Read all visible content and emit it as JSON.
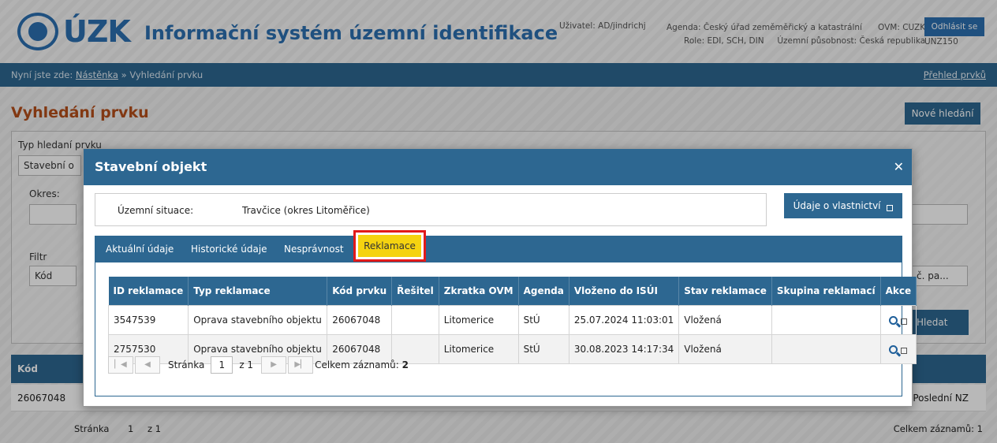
{
  "header": {
    "logo_text": "ÚZK",
    "app_title": "Informační systém územní identifikace",
    "user": "Uživatel: AD/jindrichj",
    "agenda": "Agenda: Český úřad zeměměřický a katastrální",
    "role": "Role: EDI, SCH, DIN",
    "territory": "Územní působnost: Česká republika",
    "ovm": "OVM: CUZK",
    "unz": "UNZ150",
    "logout_label": "Odhlásit se"
  },
  "breadcrumb": {
    "prefix": "Nyní jste zde:",
    "home": "Nástěnka",
    "separator": "»",
    "current": "Vyhledání prvku",
    "overview_link": "Přehled prvků"
  },
  "page": {
    "title": "Vyhledání prvku",
    "new_search_label": "Nové hledání",
    "search_type_label": "Typ hledaní prvku",
    "search_type_value": "Stavební o",
    "district_label": "Okres:",
    "filter_label": "Filtr",
    "filter_value": "Kód",
    "filter_right_value": "č. pa...",
    "search_button": "Hledat",
    "result_header_code": "Kód",
    "result_row_code": "26067048",
    "result_row_last": "Poslední NZ",
    "pager_page": "Stránka",
    "pager_value": "1",
    "pager_of": "z 1",
    "total_records": "Celkem záznamů: 1"
  },
  "modal": {
    "title": "Stavební objekt",
    "close_icon": "close-icon",
    "situation_label": "Územní situace:",
    "situation_value": "Travčice (okres Litoměřice)",
    "owner_button": "Údaje o vlastnictví",
    "tabs": [
      {
        "label": "Aktuální údaje"
      },
      {
        "label": "Historické údaje"
      },
      {
        "label": "Nesprávnost"
      },
      {
        "label": "Reklamace",
        "active": true
      }
    ],
    "table": {
      "columns": [
        "ID reklamace",
        "Typ reklamace",
        "Kód prvku",
        "Řešitel",
        "Zkratka OVM",
        "Agenda",
        "Vloženo do ISÚI",
        "Stav reklamace",
        "Skupina reklamací",
        "Akce"
      ],
      "rows": [
        [
          "3547539",
          "Oprava stavebního objektu",
          "26067048",
          "",
          "Litomerice",
          "StÚ",
          "25.07.2024 11:03:01",
          "Vložená",
          ""
        ],
        [
          "2757530",
          "Oprava stavebního objektu",
          "26067048",
          "",
          "Litomerice",
          "StÚ",
          "30.08.2023 14:17:34",
          "Vložená",
          ""
        ]
      ]
    },
    "pager": {
      "page_label": "Stránka",
      "page_value": "1",
      "of_label": "z 1",
      "total_label": "Celkem záznamů:",
      "total_value": "2"
    }
  },
  "colors": {
    "primary": "#2d6791",
    "brand": "#2c6fb0",
    "title": "#b54e1a",
    "active_tab": "#f5d310",
    "highlight": "#e21a1a"
  }
}
